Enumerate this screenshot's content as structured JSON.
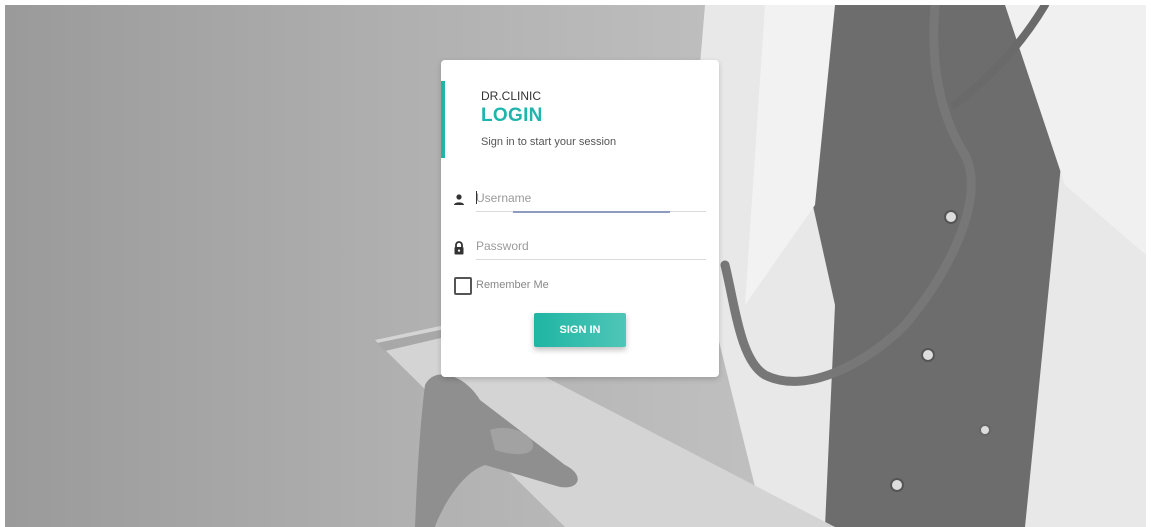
{
  "login": {
    "brand": "DR.CLINIC",
    "title": "LOGIN",
    "subtitle": "Sign in to start your session",
    "username": {
      "value": "",
      "placeholder": "Username",
      "icon": "person-icon"
    },
    "password": {
      "value": "",
      "placeholder": "Password",
      "icon": "lock-icon"
    },
    "remember": {
      "label": "Remember Me",
      "checked": false
    },
    "submit_label": "SIGN IN"
  },
  "colors": {
    "accent": "#1fb5ad",
    "button_start": "#1fb5a4",
    "button_end": "#4fc6b7",
    "focus_underline": "#8e9bbf"
  }
}
